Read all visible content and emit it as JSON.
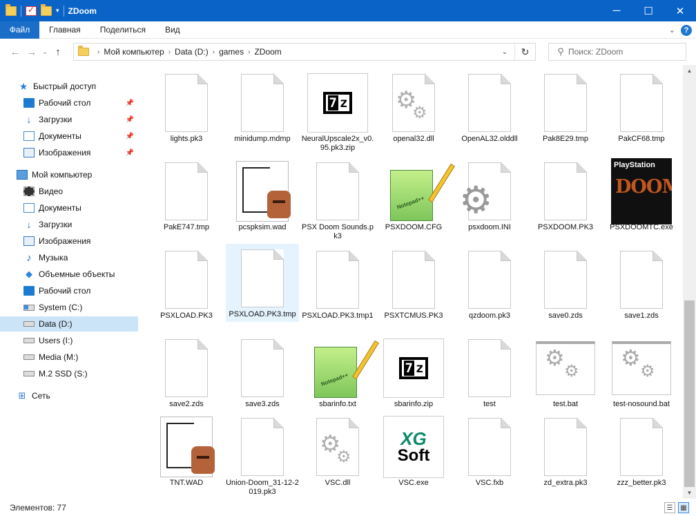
{
  "window": {
    "title": "ZDoom"
  },
  "ribbon": {
    "tabs": [
      "Файл",
      "Главная",
      "Поделиться",
      "Вид"
    ]
  },
  "address": {
    "crumbs": [
      "Мой компьютер",
      "Data (D:)",
      "games",
      "ZDoom"
    ]
  },
  "search": {
    "placeholder": "Поиск: ZDoom"
  },
  "sidebar": {
    "items": [
      {
        "label": "Быстрый доступ",
        "icon": "star-icon"
      },
      {
        "label": "Рабочий стол",
        "icon": "desktop-icon",
        "pinned": true
      },
      {
        "label": "Загрузки",
        "icon": "downloads-icon",
        "pinned": true
      },
      {
        "label": "Документы",
        "icon": "documents-icon",
        "pinned": true
      },
      {
        "label": "Изображения",
        "icon": "images-icon",
        "pinned": true
      },
      {
        "label": "Мой компьютер",
        "icon": "computer-icon"
      },
      {
        "label": "Видео",
        "icon": "video-icon"
      },
      {
        "label": "Документы",
        "icon": "documents-icon"
      },
      {
        "label": "Загрузки",
        "icon": "downloads-icon"
      },
      {
        "label": "Изображения",
        "icon": "images-icon"
      },
      {
        "label": "Музыка",
        "icon": "music-icon"
      },
      {
        "label": "Объемные объекты",
        "icon": "3d-objects-icon"
      },
      {
        "label": "Рабочий стол",
        "icon": "desktop-icon"
      },
      {
        "label": "System (C:)",
        "icon": "system-drive-icon"
      },
      {
        "label": "Data (D:)",
        "icon": "drive-icon",
        "selected": true
      },
      {
        "label": "Users (I:)",
        "icon": "drive-icon"
      },
      {
        "label": "Media (M:)",
        "icon": "drive-icon"
      },
      {
        "label": "M.2 SSD (S:)",
        "icon": "drive-icon"
      },
      {
        "label": "Сеть",
        "icon": "network-icon"
      }
    ]
  },
  "files": [
    {
      "name": "lights.pk3",
      "type": "doc"
    },
    {
      "name": "minidump.mdmp",
      "type": "doc"
    },
    {
      "name": "NeuralUpscale2x_v0.95.pk3.zip",
      "type": "zip"
    },
    {
      "name": "openal32.dll",
      "type": "dll"
    },
    {
      "name": "OpenAL32.olddll",
      "type": "doc"
    },
    {
      "name": "Pak8E29.tmp",
      "type": "doc"
    },
    {
      "name": "PakCF68.tmp",
      "type": "doc"
    },
    {
      "name": "PakE747.tmp",
      "type": "doc"
    },
    {
      "name": "pcspksim.wad",
      "type": "wad"
    },
    {
      "name": "PSX Doom Sounds.pk3",
      "type": "doc"
    },
    {
      "name": "PSXDOOM.CFG",
      "type": "notepad"
    },
    {
      "name": "psxdoom.INI",
      "type": "ini"
    },
    {
      "name": "PSXDOOM.PK3",
      "type": "doc"
    },
    {
      "name": "PSXDOOMTC.exe",
      "type": "psx"
    },
    {
      "name": "PSXLOAD.PK3",
      "type": "doc"
    },
    {
      "name": "PSXLOAD.PK3.tmp",
      "type": "doc",
      "selected": true
    },
    {
      "name": "PSXLOAD.PK3.tmp1",
      "type": "doc"
    },
    {
      "name": "PSXTCMUS.PK3",
      "type": "doc"
    },
    {
      "name": "qzdoom.pk3",
      "type": "doc"
    },
    {
      "name": "save0.zds",
      "type": "doc"
    },
    {
      "name": "save1.zds",
      "type": "doc"
    },
    {
      "name": "save2.zds",
      "type": "doc"
    },
    {
      "name": "save3.zds",
      "type": "doc"
    },
    {
      "name": "sbarinfo.txt",
      "type": "notepad"
    },
    {
      "name": "sbarinfo.zip",
      "type": "zip"
    },
    {
      "name": "test",
      "type": "doc"
    },
    {
      "name": "test.bat",
      "type": "bat"
    },
    {
      "name": "test-nosound.bat",
      "type": "bat"
    },
    {
      "name": "TNT.WAD",
      "type": "wad"
    },
    {
      "name": "Union-Doom_31-12-2019.pk3",
      "type": "doc"
    },
    {
      "name": "VSC.dll",
      "type": "dll"
    },
    {
      "name": "VSC.exe",
      "type": "xg"
    },
    {
      "name": "VSC.fxb",
      "type": "doc"
    },
    {
      "name": "zd_extra.pk3",
      "type": "doc"
    },
    {
      "name": "zzz_better.pk3",
      "type": "doc"
    }
  ],
  "psx_icon": {
    "brand": "PlayStation",
    "logo": "DOOM"
  },
  "zip_icon": {
    "glyph1": "7",
    "glyph2": "z"
  },
  "xg_icon": {
    "line1": "XG",
    "line2": "Soft"
  },
  "status": {
    "count_label": "Элементов: 77"
  },
  "colors": {
    "titlebar": "#0a64c8",
    "file_tab": "#1a6ec7",
    "selection": "#cce4f7",
    "item_selection": "#e5f3ff"
  }
}
